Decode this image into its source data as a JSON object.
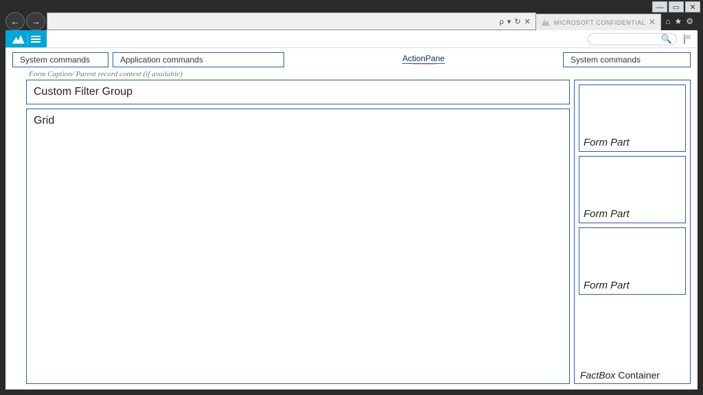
{
  "window": {
    "minimize": "—",
    "restore": "▭",
    "close": "✕",
    "home": "⌂",
    "star": "★",
    "gear": "⚙"
  },
  "browser": {
    "back": "←",
    "forward": "→",
    "address_right": "ρ ▾ ↻ ✕",
    "tab_label": "MICROSOFT CONFIDENTIAL",
    "tab_close": "✕"
  },
  "app_header": {
    "search_icon": "🔍"
  },
  "action_pane": {
    "label": "ActionPane",
    "squiggle": "~~~~~~~~~",
    "system_left": "System commands",
    "application": "Application commands",
    "system_right": "System commands"
  },
  "caption": "Form Caption/ Parent record context (if available)",
  "main": {
    "custom_filter_group": "Custom Filter Group",
    "grid": "Grid"
  },
  "factbox": {
    "form_part_1": "Form Part",
    "form_part_2": "Form Part",
    "form_part_3": "Form Part",
    "container_italic": "FactBox",
    "container_rest": " Container"
  }
}
